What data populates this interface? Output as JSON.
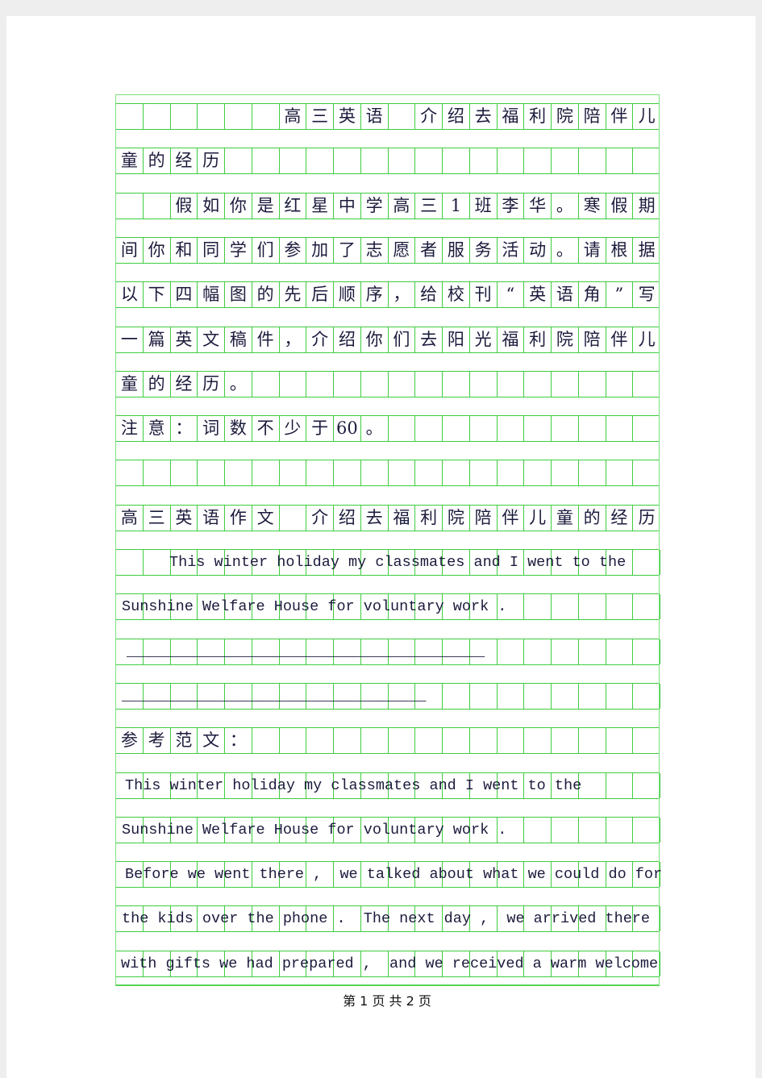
{
  "grid_color": "#3fcc3f",
  "rows": [
    {
      "cells": [
        "",
        "",
        "",
        "",
        "",
        "",
        "高",
        "三",
        "英",
        "语",
        "",
        "介",
        "绍",
        "去",
        "福",
        "利",
        "院",
        "陪",
        "伴",
        "儿"
      ]
    },
    {
      "cells": [
        "童",
        "的",
        "经",
        "历"
      ]
    },
    {
      "cells": [
        "",
        "",
        "假",
        "如",
        "你",
        "是",
        "红",
        "星",
        "中",
        "学",
        "高",
        "三",
        "1",
        "班",
        "李",
        "华",
        "。",
        "寒",
        "假",
        "期"
      ]
    },
    {
      "cells": [
        "间",
        "你",
        "和",
        "同",
        "学",
        "们",
        "参",
        "加",
        "了",
        "志",
        "愿",
        "者",
        "服",
        "务",
        "活",
        "动",
        "。",
        "请",
        "根",
        "据"
      ]
    },
    {
      "cells": [
        "以",
        "下",
        "四",
        "幅",
        "图",
        "的",
        "先",
        "后",
        "顺",
        "序",
        "，",
        "给",
        "校",
        "刊",
        "“",
        "英",
        "语",
        "角",
        "”",
        "写"
      ]
    },
    {
      "cells": [
        "一",
        "篇",
        "英",
        "文",
        "稿",
        "件",
        "，",
        "介",
        "绍",
        "你",
        "们",
        "去",
        "阳",
        "光",
        "福",
        "利",
        "院",
        "陪",
        "伴",
        "儿"
      ]
    },
    {
      "cells": [
        "童",
        "的",
        "经",
        "历",
        "。"
      ]
    },
    {
      "cells": [
        "注",
        "意",
        "：",
        "词",
        "数",
        "不",
        "少",
        "于",
        "60",
        "。"
      ]
    },
    {
      "cells": []
    },
    {
      "cells": [
        "高",
        "三",
        "英",
        "语",
        "作",
        "文",
        "",
        "介",
        "绍",
        "去",
        "福",
        "利",
        "院",
        "陪",
        "伴",
        "儿",
        "童",
        "的",
        "经",
        "历"
      ]
    },
    {
      "text": "This winter holiday my classmates and I went to the"
    },
    {
      "text": "Sunshine Welfare House for voluntary work ."
    },
    {
      "text": "________________________________________"
    },
    {
      "text": "__________________________________"
    },
    {
      "cells": [
        "参",
        "考",
        "范",
        "文",
        "："
      ]
    },
    {
      "text": "This winter holiday my classmates and I went to the"
    },
    {
      "text": "Sunshine Welfare House for voluntary work ."
    },
    {
      "text": "Before we went there ,  we talked about what we could do for"
    },
    {
      "text": "the kids over the phone .  The next day ,  we arrived there"
    },
    {
      "text": "with gifts we had prepared ,  and we received a warm welcome"
    }
  ],
  "footer": "第 1 页 共 2 页"
}
